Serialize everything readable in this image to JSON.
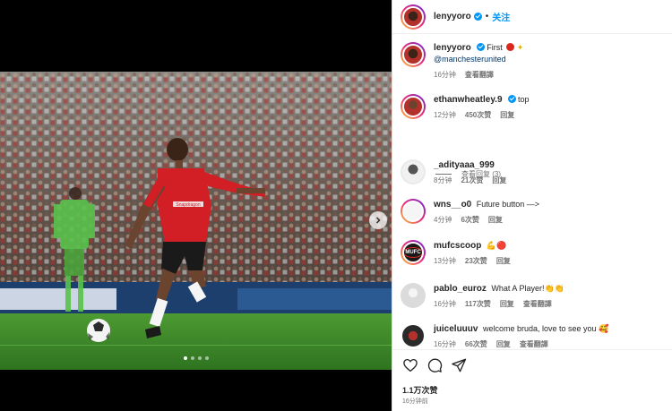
{
  "post": {
    "author": "lenyyoro",
    "separator": "•",
    "follow_label": "关注"
  },
  "media": {
    "photo_alt": "Player striking a football on the pitch in front of a crowd",
    "jersey_sponsor": "Snapdragon",
    "carousel_dots": 4,
    "carousel_active_index": 0
  },
  "caption": {
    "author": "lenyyoro",
    "text": "First",
    "mention": "@manchesterunited",
    "time": "16分钟",
    "translate": "查看翻譯"
  },
  "comments": [
    {
      "author": "ethanwheatley.9",
      "verified": true,
      "text": "top",
      "time": "12分钟",
      "likes": "450次赞",
      "reply": "回复",
      "translate": ""
    },
    {
      "author": "_adityaaa_999",
      "verified": false,
      "text": "",
      "time": "8分钟",
      "likes": "21次赞",
      "reply": "回复",
      "translate": ""
    },
    {
      "author": "wns__o0",
      "verified": false,
      "text": "Future button —>",
      "time": "4分钟",
      "likes": "6次赞",
      "reply": "回复",
      "translate": ""
    },
    {
      "author": "mufcscoop",
      "verified": false,
      "text": "💪🔴",
      "time": "13分钟",
      "likes": "23次赞",
      "reply": "回复",
      "translate": ""
    },
    {
      "author": "pablo_euroz",
      "verified": false,
      "text": "What A Player!👏👏",
      "time": "16分钟",
      "likes": "117次赞",
      "reply": "回复",
      "translate": "查看翻譯"
    },
    {
      "author": "juiceluuuv",
      "verified": false,
      "text": "welcome bruda, love to see you 🥰",
      "time": "16分钟",
      "likes": "66次赞",
      "reply": "回复",
      "translate": "查看翻譯"
    }
  ],
  "view_replies": "查看回复 (3)",
  "avatars": {
    "mufcscoop_label": "MUFC"
  },
  "footer": {
    "likes": "1.1万次赞",
    "posted": "16分钟前"
  },
  "colors": {
    "verified": "#0095f6",
    "follow": "#0095f6",
    "united_red": "#da291c",
    "pitch": "#3f8a2a"
  },
  "icons": [
    "heart-icon",
    "comment-icon",
    "share-icon",
    "verified-badge-icon",
    "chevron-right-icon"
  ]
}
